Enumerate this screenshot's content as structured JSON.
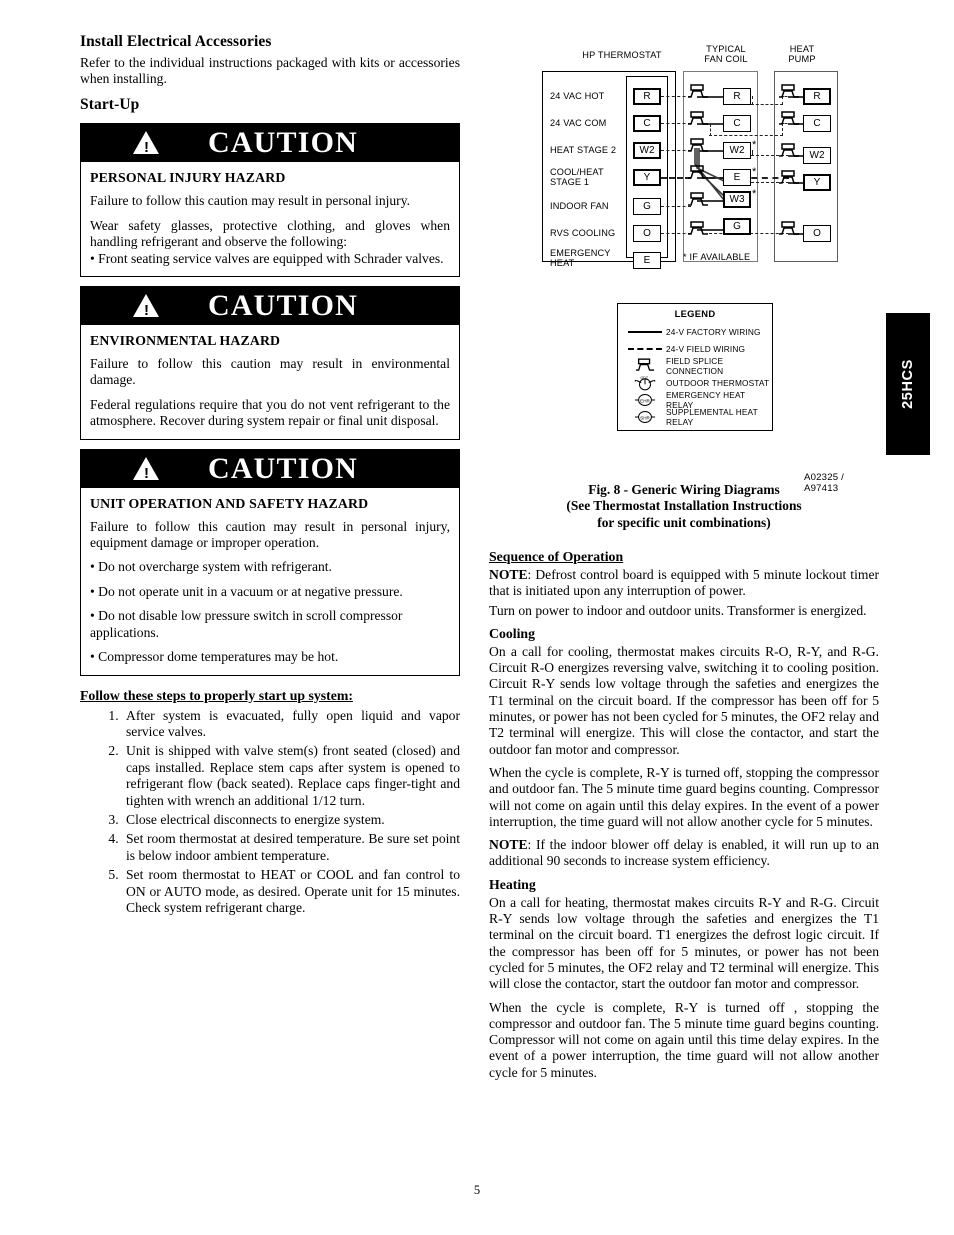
{
  "left_column": {
    "section_title": "Install Electrical Accessories",
    "intro_paragraph": "Refer to the individual instructions packaged with kits or accessories when installing.",
    "startup_title": "Start-Up",
    "caution_word": "CAUTION",
    "caution_boxes": [
      {
        "hazard_title": "PERSONAL INJURY HAZARD",
        "paragraphs": [
          "Failure to follow this caution may result in personal injury.",
          "Wear safety glasses, protective clothing, and gloves when handling refrigerant and observe the following:"
        ],
        "bullets": [
          "• Front seating service valves are equipped with Schrader valves."
        ]
      },
      {
        "hazard_title": "ENVIRONMENTAL HAZARD",
        "paragraphs": [
          "Failure to follow this caution may result in environmental damage.",
          "Federal regulations require that you do not vent refrigerant to the atmosphere. Recover during system repair or final unit disposal."
        ],
        "bullets": []
      },
      {
        "hazard_title": "UNIT OPERATION AND SAFETY HAZARD",
        "paragraphs": [
          "Failure to follow this caution may result in personal injury, equipment damage or improper operation."
        ],
        "bullets": [
          "• Do not overcharge system with refrigerant.",
          "• Do not operate unit in a vacuum or at negative pressure.",
          "• Do not disable low pressure switch in scroll compressor   applications.",
          "• Compressor dome temperatures may be hot."
        ]
      }
    ],
    "steps_title": "Follow these steps to properly start up system:",
    "steps": [
      "After system is evacuated, fully   open liquid and vapor service valves.",
      "Unit is shipped with valve stem(s) front seated (closed) and caps installed. Replace stem caps after system is opened to refrigerant flow (back seated). Replace caps finger-tight and tighten with wrench an additional 1/12 turn.",
      "Close electrical disconnects to energize system.",
      "Set room thermostat at desired temperature. Be sure set point is below indoor ambient temperature.",
      "Set room thermostat to HEAT or COOL and fan control to ON or AUTO mode, as desired. Operate unit for 15 minutes. Check system refrigerant charge."
    ]
  },
  "diagram": {
    "column_headers": [
      {
        "line1": "HP THERMOSTAT",
        "line2": ""
      },
      {
        "line1": "TYPICAL",
        "line2": "FAN COIL"
      },
      {
        "line1": "HEAT",
        "line2": "PUMP"
      }
    ],
    "thermostat_rows": [
      {
        "label_line1": "24 VAC HOT",
        "label_line2": "",
        "terminal": "R"
      },
      {
        "label_line1": "24 VAC COM",
        "label_line2": "",
        "terminal": "C"
      },
      {
        "label_line1": "HEAT STAGE 2",
        "label_line2": "",
        "terminal": "W2"
      },
      {
        "label_line1": "COOL/HEAT",
        "label_line2": "STAGE 1",
        "terminal": "Y"
      },
      {
        "label_line1": "INDOOR FAN",
        "label_line2": "",
        "terminal": "G"
      },
      {
        "label_line1": "RVS COOLING",
        "label_line2": "",
        "terminal": "O"
      },
      {
        "label_line1": "EMERGENCY",
        "label_line2": "HEAT",
        "terminal": "E"
      }
    ],
    "fan_coil_terminals": [
      {
        "terminal": "R",
        "star": false
      },
      {
        "terminal": "C",
        "star": false
      },
      {
        "terminal": "W2",
        "star": true
      },
      {
        "terminal": "E",
        "star": true
      },
      {
        "terminal": "W3",
        "star": true
      },
      {
        "terminal": "G",
        "star": false
      }
    ],
    "heat_pump_terminals": [
      "R",
      "C",
      "W2",
      "Y",
      "O"
    ],
    "footnote": "* IF AVAILABLE",
    "legend": {
      "title": "LEGEND",
      "rows": [
        {
          "symbol": "solid-line",
          "text": "24-V FACTORY WIRING"
        },
        {
          "symbol": "dashed-line",
          "text": "24-V FIELD WIRING"
        },
        {
          "symbol": "splice-icon",
          "text": "FIELD SPLICE CONNECTION"
        },
        {
          "symbol": "thermostat-icon",
          "text": "OUTDOOR THERMOSTAT"
        },
        {
          "symbol": "ehr-relay-icon",
          "text": "EMERGENCY HEAT RELAY"
        },
        {
          "symbol": "shr-relay-icon",
          "text": "SUPPLEMENTAL HEAT RELAY"
        }
      ]
    },
    "figure_id": "A02325 / A97413",
    "figure_caption_line1": "Fig. 8 - Generic Wiring Diagrams",
    "figure_caption_line2": "(See Thermostat Installation Instructions",
    "figure_caption_line3": "for specific unit combinations)"
  },
  "sequence": {
    "title": "Sequence of Operation",
    "note1_label": "NOTE",
    "note1_text": ":  Defrost control board is equipped with 5 minute lockout timer that is initiated upon any interruption of power.",
    "power_para": "Turn on power to indoor and outdoor units. Transformer is energized.",
    "cooling_title": "Cooling",
    "cooling_para1": "On a call for cooling, thermostat makes circuits R-O, R-Y, and R-G. Circuit R-O energizes reversing valve, switching it to cooling position. Circuit R-Y sends low voltage through the safeties and energizes the T1 terminal on the circuit board. If the compressor has been off for 5 minutes, or power has not been cycled for 5 minutes, the OF2 relay and T2 terminal will energize. This will close the contactor, and start the outdoor fan motor and compressor.",
    "cooling_para2": "When the cycle is complete, R-Y is turned off,  stopping the compressor and outdoor fan. The 5 minute time guard begins counting. Compressor will not come on again until this delay expires. In the event of a power interruption, the time guard will not allow another cycle for 5 minutes.",
    "note2_label": "NOTE",
    "note2_text": ":  If the indoor blower off delay is enabled, it will run up to an additional 90 seconds to increase system efficiency.",
    "heating_title": "Heating",
    "heating_para1": "On a call for heating, thermostat makes circuits R-Y and R-G. Circuit R-Y sends low voltage through the safeties and energizes the T1 terminal on the circuit board. T1 energizes the defrost logic circuit. If the compressor has been off for 5 minutes, or power has not been cycled for 5 minutes, the OF2 relay and T2 terminal will energize. This will close the contactor, start the outdoor fan motor and compressor.",
    "heating_para2": "When the cycle is complete, R-Y is turned off , stopping the compressor and outdoor fan. The 5 minute time guard begins counting. Compressor will not come on again until this time delay expires. In the event of a power interruption, the time guard will not allow another cycle for 5 minutes."
  },
  "side_tab": {
    "label": "25HCS"
  },
  "page_number": "5"
}
